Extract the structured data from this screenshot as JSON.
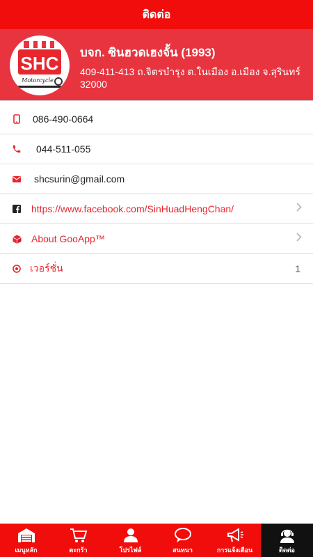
{
  "topbar": {
    "title": "ติดต่อ"
  },
  "header": {
    "logo_text": "SHC",
    "logo_sub": "Motorcycle",
    "company_name": "บจก. ซินฮวดเฮงจั้น (1993)",
    "address": "409-411-413 ถ.จิตรบำรุง ต.ในเมือง อ.เมือง จ.สุรินทร์ 32000"
  },
  "contacts": {
    "mobile": "086-490-0664",
    "phone": "044-511-055",
    "email": "shcsurin@gmail.com",
    "facebook": "https://www.facebook.com/SinHuadHengChan/",
    "about": "About GooApp™",
    "version_label": "เวอร์ชั่น",
    "version_value": "1"
  },
  "colors": {
    "primary": "#f20d0d",
    "header": "#e8343f",
    "accent_text": "#e8262e",
    "active_tab": "#111111"
  },
  "tabs": [
    {
      "label": "เมนูหลัก",
      "icon": "garage-icon",
      "active": false
    },
    {
      "label": "ตะกร้า",
      "icon": "cart-icon",
      "active": false
    },
    {
      "label": "โปรไฟล์",
      "icon": "profile-icon",
      "active": false
    },
    {
      "label": "สนทนา",
      "icon": "chat-icon",
      "active": false
    },
    {
      "label": "การแจ้งเตือน",
      "icon": "megaphone-icon",
      "active": false
    },
    {
      "label": "ติดต่อ",
      "icon": "support-agent-icon",
      "active": true
    }
  ]
}
